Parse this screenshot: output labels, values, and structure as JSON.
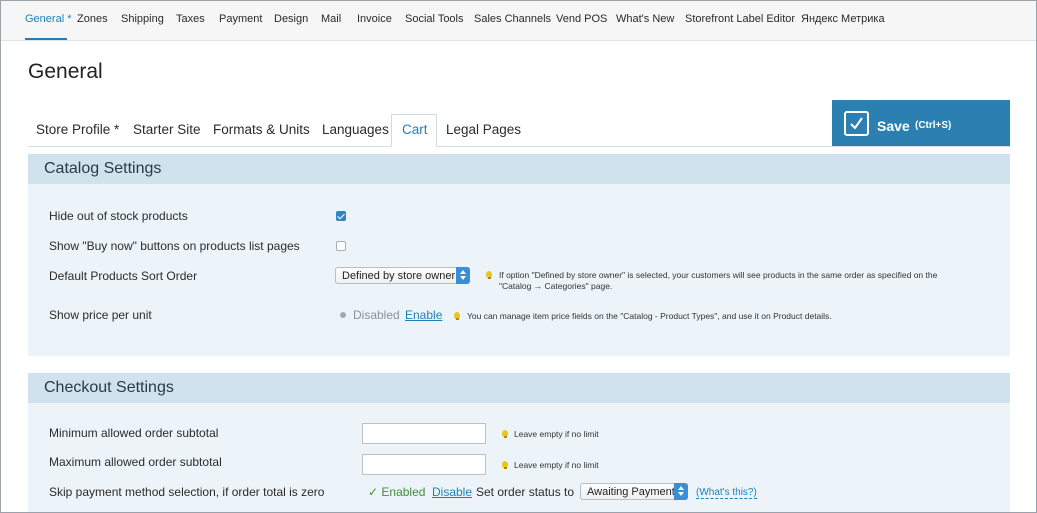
{
  "topnav": {
    "items": [
      "General *",
      "Zones",
      "Shipping",
      "Taxes",
      "Payment",
      "Design",
      "Mail",
      "Invoice",
      "Social Tools",
      "Sales Channels",
      "Vend POS",
      "What's New",
      "Storefront Label Editor",
      "Яндекс Метрика"
    ],
    "active_index": 0
  },
  "page": {
    "title": "General"
  },
  "tabs": {
    "items": [
      "Store Profile *",
      "Starter Site",
      "Formats & Units",
      "Languages",
      "Cart",
      "Legal Pages"
    ],
    "active_index": 4
  },
  "save": {
    "label": "Save",
    "shortcut": "(Ctrl+S)"
  },
  "catalog": {
    "title": "Catalog Settings",
    "hide_out_of_stock": {
      "label": "Hide out of stock products",
      "checked": true
    },
    "buy_now": {
      "label": "Show \"Buy now\" buttons on products list pages",
      "checked": false
    },
    "sort_order": {
      "label": "Default Products Sort Order",
      "selected": "Defined by store owner",
      "hint_line1": "If option \"Defined by store owner\" is selected, your customers will see products in the same order as specified on the",
      "hint_line2": "\"Catalog → Categories\" page."
    },
    "price_per_unit": {
      "label": "Show price per unit",
      "status": "Disabled",
      "action": "Enable",
      "hint": "You can manage item price fields on the \"Catalog - Product Types\", and use it on Product details."
    }
  },
  "checkout": {
    "title": "Checkout Settings",
    "min_subtotal": {
      "label": "Minimum allowed order subtotal",
      "value": "",
      "hint": "Leave empty if no limit"
    },
    "max_subtotal": {
      "label": "Maximum allowed order subtotal",
      "value": "",
      "hint": "Leave empty if no limit"
    },
    "skip_payment": {
      "label": "Skip payment method selection, if order total is zero",
      "status": "✓ Enabled",
      "action": "Disable",
      "order_status_label": "Set order status to",
      "order_status": "Awaiting Payment",
      "help": "(What's this?)"
    }
  },
  "colors": {
    "accent": "#1f80b8",
    "save_bg": "#2c7fb1",
    "panel_header": "#cfe2ee",
    "panel_body": "#edf4f9"
  }
}
